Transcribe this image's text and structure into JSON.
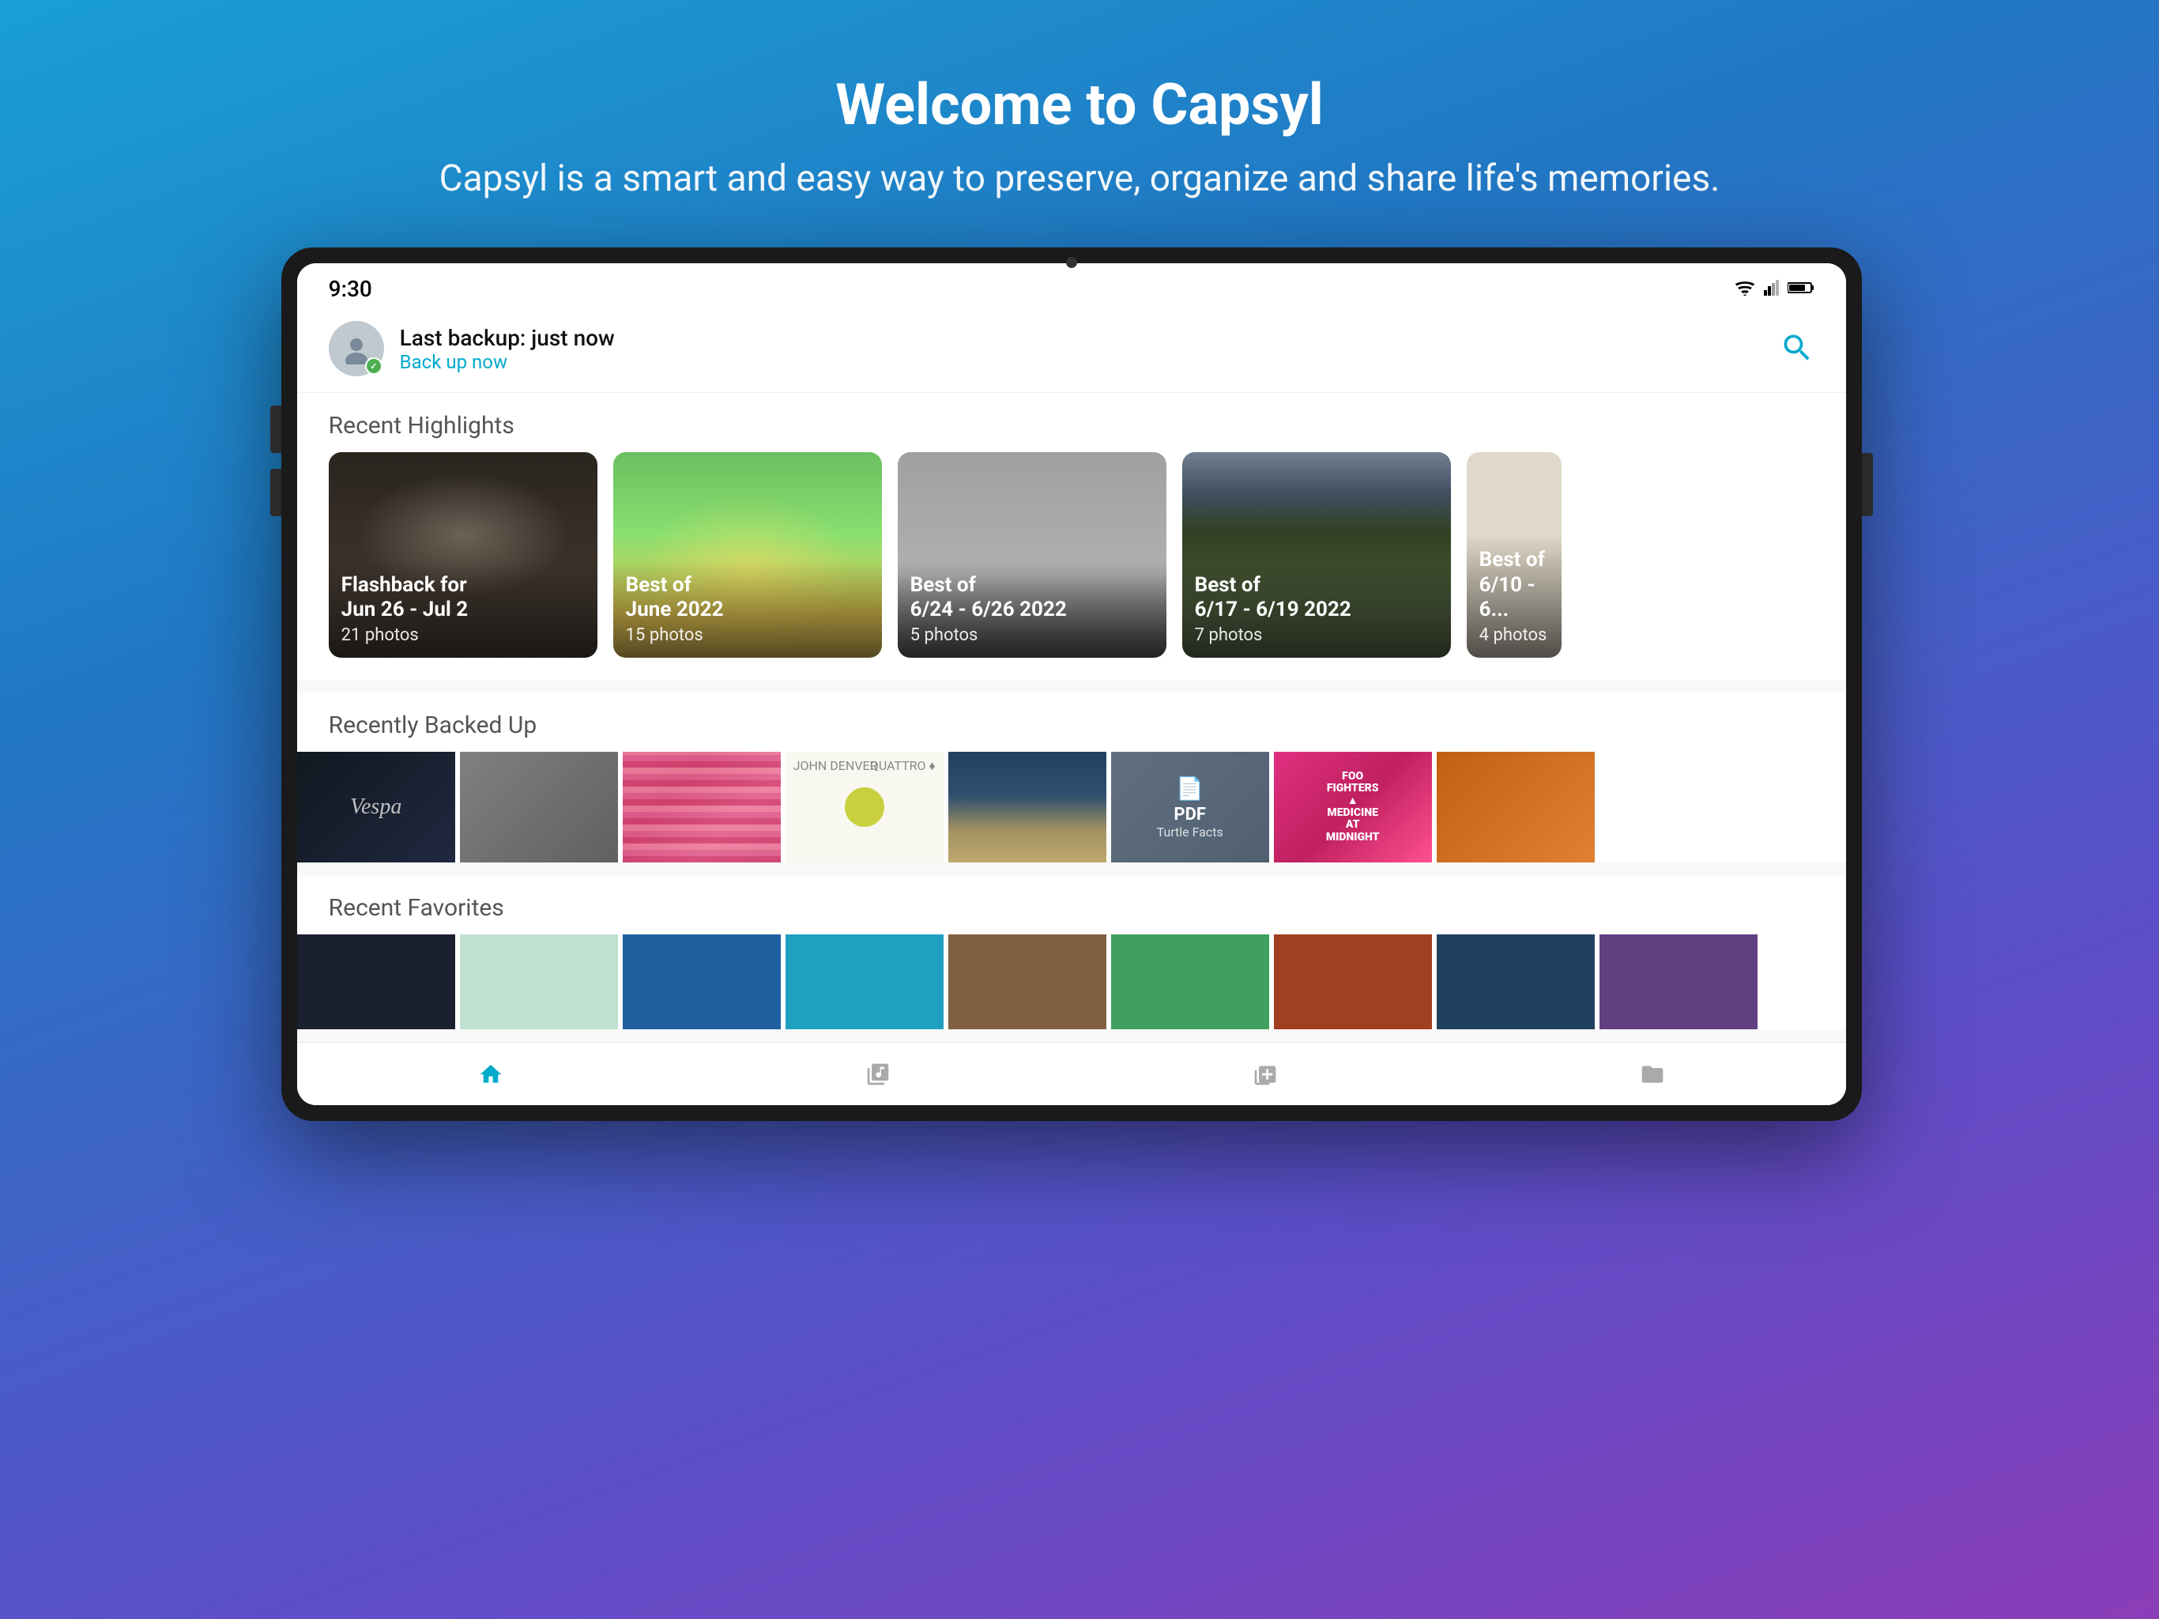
{
  "page": {
    "title": "Welcome to Capsyl",
    "subtitle": "Capsyl is a smart and easy way to preserve, organize and share life's memories."
  },
  "statusBar": {
    "time": "9:30",
    "wifi": "▼",
    "signal": "▲",
    "battery": "🔋"
  },
  "appHeader": {
    "backupStatus": "Last backup: just now",
    "backupLink": "Back up now"
  },
  "sections": {
    "highlights": {
      "title": "Recent Highlights",
      "cards": [
        {
          "id": 1,
          "title": "Flashback for Jun 26 - Jul 2",
          "count": "21 photos",
          "scene": "hands"
        },
        {
          "id": 2,
          "title": "Best of June 2022",
          "count": "15 photos",
          "scene": "kid"
        },
        {
          "id": 3,
          "title": "Best of 6/24 - 6/26 2022",
          "count": "5 photos",
          "scene": "skate"
        },
        {
          "id": 4,
          "title": "Best of 6/17 - 6/19 2022",
          "count": "7 photos",
          "scene": "forest"
        },
        {
          "id": 5,
          "title": "Best of 6/10 - 6/...",
          "count": "4 photos",
          "scene": "room"
        }
      ]
    },
    "recentBackup": {
      "title": "Recently Backed Up",
      "thumbs": [
        {
          "id": 1,
          "type": "image",
          "style": "ts1",
          "label": "Vespa"
        },
        {
          "id": 2,
          "type": "image",
          "style": "ts2",
          "label": ""
        },
        {
          "id": 3,
          "type": "image",
          "style": "ts3",
          "label": ""
        },
        {
          "id": 4,
          "type": "album",
          "style": "ts4",
          "label": ""
        },
        {
          "id": 5,
          "type": "image",
          "style": "ts5",
          "label": ""
        },
        {
          "id": 6,
          "type": "pdf",
          "style": "ts6",
          "pdfTitle": "PDF",
          "pdfName": "Turtle Facts"
        },
        {
          "id": 7,
          "type": "image",
          "style": "ts7",
          "label": "Foo Fighters"
        },
        {
          "id": 8,
          "type": "image",
          "style": "ts8",
          "label": ""
        }
      ]
    },
    "recentFavorites": {
      "title": "Recent Favorites"
    }
  },
  "bottomNav": {
    "items": [
      {
        "id": "home",
        "label": "Home",
        "active": true
      },
      {
        "id": "albums",
        "label": "Albums",
        "active": false
      },
      {
        "id": "library",
        "label": "Library",
        "active": false
      },
      {
        "id": "folder",
        "label": "Folders",
        "active": false
      }
    ]
  }
}
